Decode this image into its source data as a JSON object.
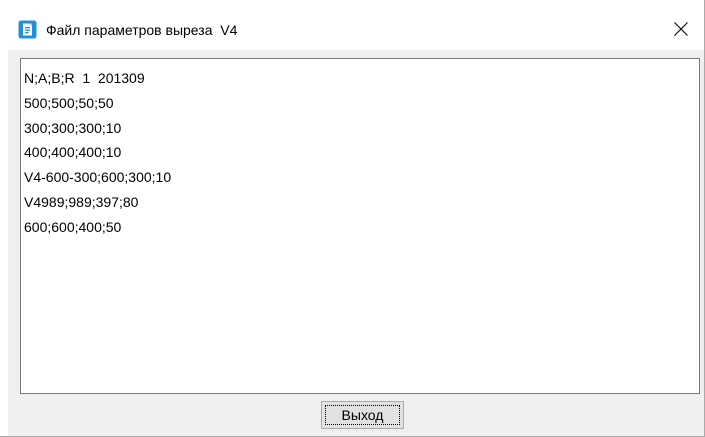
{
  "window": {
    "title": "Файл параметров выреза  V4",
    "icon": "app-document-icon",
    "close_icon": "close-icon"
  },
  "content": {
    "lines": [
      "N;A;B;R  1  201309",
      "500;500;50;50",
      "300;300;300;10",
      "400;400;400;10",
      "V4-600-300;600;300;10",
      "V4989;989;397;80",
      "600;600;400;50"
    ]
  },
  "footer": {
    "exit_label": "Выход"
  },
  "colors": {
    "accent": "#1e90d6",
    "client_background": "#f0f0f0",
    "button_face": "#e1e1e1"
  }
}
